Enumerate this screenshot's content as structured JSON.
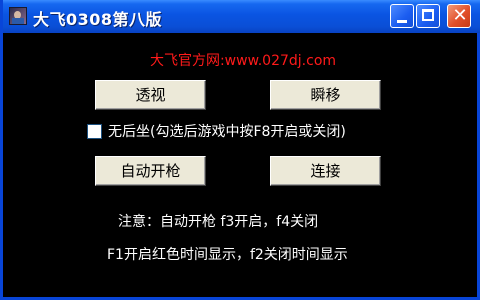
{
  "window": {
    "title": "大飞0308第八版",
    "buttons": {
      "minimize": "minimize",
      "maximize": "maximize",
      "close": "✕"
    }
  },
  "banner": "大飞官方网:www.027dj.com",
  "buttons": {
    "transparent": "透视",
    "teleport": "瞬移",
    "auto_fire": "自动开枪",
    "connect": "连接"
  },
  "checkbox": {
    "label": "无后坐(勾选后游戏中按F8开启或关闭)",
    "checked": false
  },
  "notes": {
    "line1": "注意：自动开枪 f3开启，f4关闭",
    "line2": "F1开启红色时间显示，f2关闭时间显示"
  },
  "colors": {
    "titlebar": "#0a54e2",
    "banner_text": "#ff1a1a",
    "background": "#000000",
    "button_face": "#ece9d8"
  }
}
